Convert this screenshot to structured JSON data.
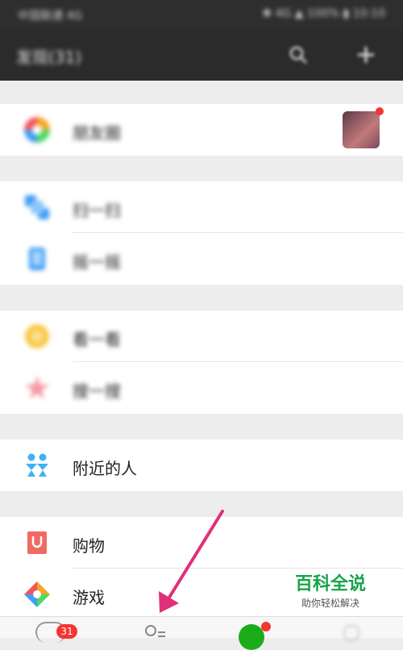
{
  "status_bar": {
    "left_text": "中国联通 4G",
    "right_text": "✱ 4G ▲ 100% ▮ 10:10"
  },
  "header": {
    "title": "发现(31)",
    "search_icon": "search-icon",
    "add_icon": "plus-icon"
  },
  "menu": {
    "moments": {
      "label": "朋友圈",
      "icon": "moments-icon"
    },
    "scan": {
      "label": "扫一扫",
      "icon": "scan-icon"
    },
    "shake": {
      "label": "摇一摇",
      "icon": "shake-icon"
    },
    "look": {
      "label": "看一看",
      "icon": "look-icon"
    },
    "search": {
      "label": "搜一搜",
      "icon": "search-icon"
    },
    "nearby": {
      "label": "附近的人",
      "icon": "nearby-people-icon"
    },
    "shopping": {
      "label": "购物",
      "icon": "shopping-bag-icon"
    },
    "games": {
      "label": "游戏",
      "icon": "game-icon"
    }
  },
  "tabbar": {
    "chats_badge": "31"
  },
  "watermark": {
    "line1": "百科全说",
    "line2": "助你轻松解决"
  },
  "colors": {
    "header_bg": "#2b2b2b",
    "arrow": "#e0307a",
    "badge": "#f43530",
    "watermark": "#17a34a"
  }
}
